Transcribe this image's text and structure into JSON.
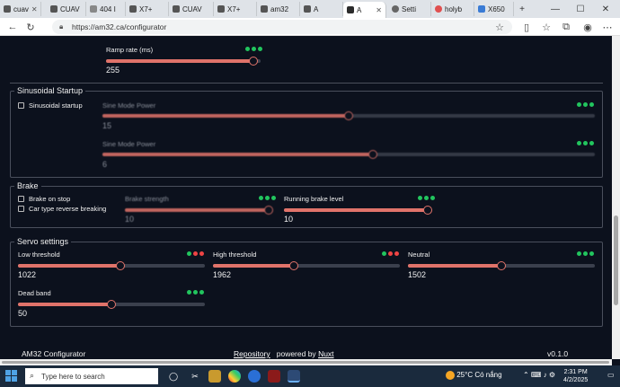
{
  "browser": {
    "tabs": [
      {
        "label": "cuav"
      },
      {
        "label": "CUAV"
      },
      {
        "label": "404 I"
      },
      {
        "label": "X7+"
      },
      {
        "label": "CUAV"
      },
      {
        "label": "X7+"
      },
      {
        "label": "am32"
      },
      {
        "label": "A"
      },
      {
        "label": "Setti"
      },
      {
        "label": "holyb"
      },
      {
        "label": "X650"
      }
    ],
    "address": "https://am32.ca/configurator",
    "controls": {
      "minimize": "—",
      "maximize": "☐",
      "close": "✕",
      "new_tab": "+"
    }
  },
  "ramp": {
    "label": "Ramp rate (ms)",
    "value": "255",
    "fraction": 0.98,
    "dots": [
      "#22c55e",
      "#22c55e",
      "#22c55e"
    ]
  },
  "sinusoidal": {
    "legend": "Sinusoidal Startup",
    "checkbox_label": "Sinusoidal startup",
    "sine_power_1": {
      "label": "Sine Mode Power",
      "value": "15",
      "fraction": 0.5,
      "dots": [
        "#22c55e",
        "#22c55e",
        "#22c55e"
      ]
    },
    "sine_power_2": {
      "label": "Sine Mode Power",
      "value": "6",
      "fraction": 0.55,
      "dots": [
        "#22c55e",
        "#22c55e",
        "#22c55e"
      ]
    }
  },
  "brake": {
    "legend": "Brake",
    "brake_on_stop": "Brake on stop",
    "reverse_braking": "Car type reverse breaking",
    "strength": {
      "label": "Brake strength",
      "value": "10",
      "fraction": 1.0,
      "dots": [
        "#22c55e",
        "#22c55e",
        "#22c55e"
      ]
    },
    "running": {
      "label": "Running brake level",
      "value": "10",
      "fraction": 1.0,
      "dots": [
        "#22c55e",
        "#22c55e",
        "#22c55e"
      ]
    }
  },
  "servo": {
    "legend": "Servo settings",
    "low": {
      "label": "Low threshold",
      "value": "1022",
      "fraction": 0.55,
      "dots": [
        "#22c55e",
        "#ef4444",
        "#ef4444"
      ]
    },
    "high": {
      "label": "High threshold",
      "value": "1962",
      "fraction": 0.43,
      "dots": [
        "#22c55e",
        "#ef4444",
        "#ef4444"
      ]
    },
    "neutral": {
      "label": "Neutral",
      "value": "1502",
      "fraction": 0.5,
      "dots": [
        "#22c55e",
        "#22c55e",
        "#22c55e"
      ]
    },
    "deadband": {
      "label": "Dead band",
      "value": "50",
      "fraction": 0.5,
      "dots": [
        "#22c55e",
        "#22c55e",
        "#22c55e"
      ]
    }
  },
  "footer": {
    "brand": "AM32 Configurator",
    "repository": "Repository",
    "powered_by": "powered by",
    "nuxt": "Nuxt",
    "version": "v0.1.0"
  },
  "taskbar": {
    "search_placeholder": "Type here to search",
    "weather": "25°C  Có nắng",
    "time": "2:31 PM",
    "date": "4/2/2025"
  }
}
